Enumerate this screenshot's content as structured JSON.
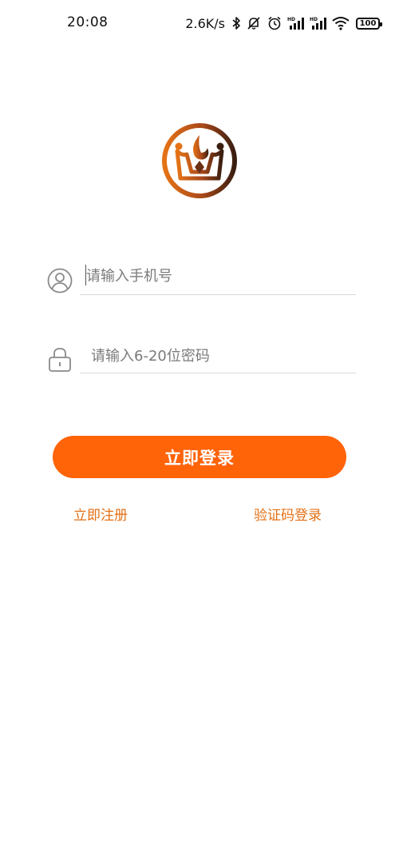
{
  "status_bar": {
    "time": "20:08",
    "net_speed": "2.6K/s",
    "icons": [
      "bluetooth-icon",
      "mute-vibrate-icon",
      "alarm-icon",
      "hd-signal-icon",
      "hd-signal-icon",
      "wifi-icon"
    ],
    "battery": "100"
  },
  "logo": {
    "icon": "crown-flame-logo",
    "colors": [
      "#e57316",
      "#3a1e10"
    ]
  },
  "form": {
    "phone": {
      "placeholder": "请输入手机号",
      "value": "",
      "icon": "user-icon"
    },
    "password": {
      "placeholder": "请输入6-20位密码",
      "value": "",
      "icon": "lock-icon"
    }
  },
  "actions": {
    "login_label": "立即登录",
    "register_label": "立即注册",
    "sms_login_label": "验证码登录"
  },
  "colors": {
    "accent": "#ff6409",
    "link": "#e46f14"
  }
}
